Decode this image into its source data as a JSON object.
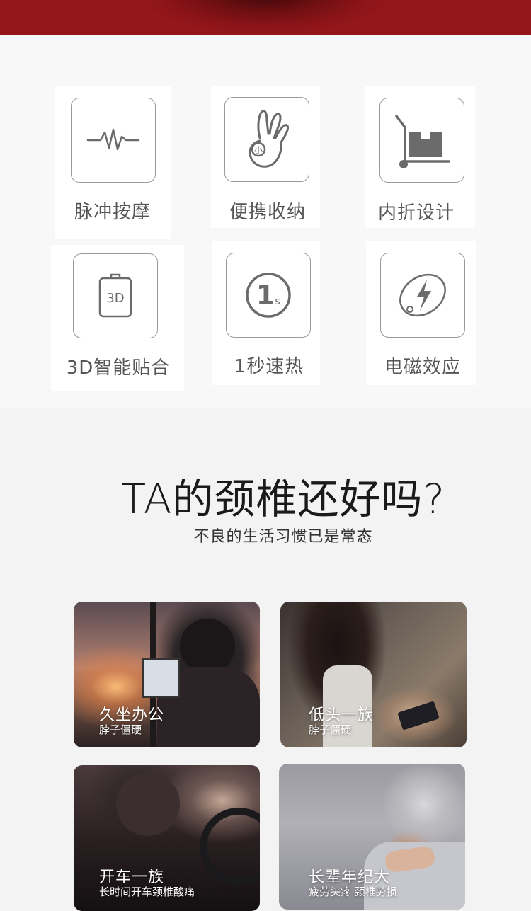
{
  "features": [
    {
      "label": "脉冲按摩",
      "icon": "pulse-wave-icon"
    },
    {
      "label": "便携收纳",
      "icon": "hand-ok-small-icon",
      "icon_text": "小"
    },
    {
      "label": "内折设计",
      "icon": "hand-truck-box-icon"
    },
    {
      "label": "3D智能贴合",
      "icon": "3d-pad-icon",
      "icon_text": "3D"
    },
    {
      "label": "1秒速热",
      "icon": "one-second-icon",
      "icon_text": "1",
      "icon_subtext": "s"
    },
    {
      "label": "电磁效应",
      "icon": "lightning-disc-icon"
    }
  ],
  "section": {
    "headline": "TA的颈椎还好吗?",
    "subheadline": "不良的生活习惯已是常态"
  },
  "scenarios": [
    {
      "title": "久坐办公",
      "subtitle": "脖子僵硬"
    },
    {
      "title": "低头一族",
      "subtitle": "脖子僵硬"
    },
    {
      "title": "开车一族",
      "subtitle": "长时间开车颈椎酸痛"
    },
    {
      "title": "长辈年纪大",
      "subtitle": "疲劳头疼 颈椎劳损"
    }
  ],
  "colors": {
    "top_bar": "#8c1418",
    "icon_border": "#9a9a9a",
    "icon_glyph": "#6b6b6b",
    "label_text": "#555555"
  }
}
